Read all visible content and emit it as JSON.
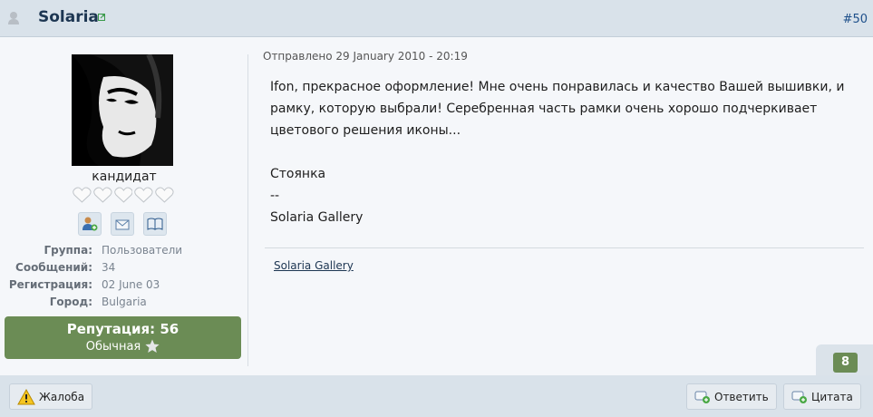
{
  "header": {
    "author_name": "Solaria",
    "post_number": "#50"
  },
  "profile": {
    "rank": "кандидат",
    "hearts_count": 5,
    "info": [
      {
        "key": "Группа:",
        "value": "Пользователи"
      },
      {
        "key": "Сообщений:",
        "value": "34"
      },
      {
        "key": "Регистрация:",
        "value": "02 June 03"
      },
      {
        "key": "Город:",
        "value": "Bulgaria"
      }
    ],
    "reputation_title": "Репутация: 56",
    "reputation_level": "Обычная"
  },
  "post": {
    "date": "Отправлено 29 January 2010 - 20:19",
    "line1": "Ifon, прекрасное оформление! Мне очень понравилась и качество Вашей вышивки, и",
    "line2": "рамку, которую выбрали! Серебренная часть рамки очень хорошо подчеркивает",
    "line3": "цветового решения иконы...",
    "line4": "Стоянка",
    "line5": "--",
    "line6": "Solaria Gallery",
    "signature": "Solaria Gallery"
  },
  "post_rating": "8",
  "footer": {
    "report_label": "Жалоба",
    "reply_label": "Ответить",
    "quote_label": "Цитата"
  },
  "colors": {
    "header_bg": "#d9e2ea",
    "reputation_green": "#6b8c55",
    "name_blue": "#1d3652"
  }
}
